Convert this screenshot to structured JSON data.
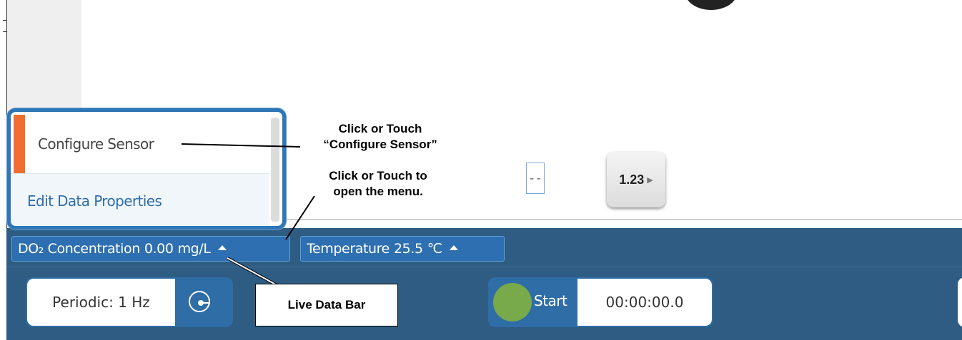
{
  "menu": {
    "items": [
      {
        "label": "Configure Sensor"
      },
      {
        "label": "Edit Data Properties"
      }
    ]
  },
  "meter": {
    "value_label": "1.23",
    "arrow": "▶",
    "dash_display": "--"
  },
  "live_bar": {
    "chips": [
      {
        "name": "DO₂ Concentration",
        "value": "0.00",
        "unit": "mg/L"
      },
      {
        "name": "Temperature",
        "value": "25.5",
        "unit": "℃"
      }
    ]
  },
  "controls": {
    "periodic_label": "Periodic: 1 Hz",
    "start_label": "Start",
    "timer": "00:00:00.0"
  },
  "callouts": {
    "configure_line1": "Click or Touch",
    "configure_line2": "“Configure Sensor”",
    "open_line1": "Click or Touch to",
    "open_line2": "open the menu.",
    "live_data_bar": "Live Data Bar"
  },
  "colors": {
    "bar_background": "#2e5c82",
    "chip_fill": "#2d6fb0",
    "menu_border": "#2e76b5",
    "accent_orange": "#f06e2f",
    "start_green": "#78a94a"
  }
}
